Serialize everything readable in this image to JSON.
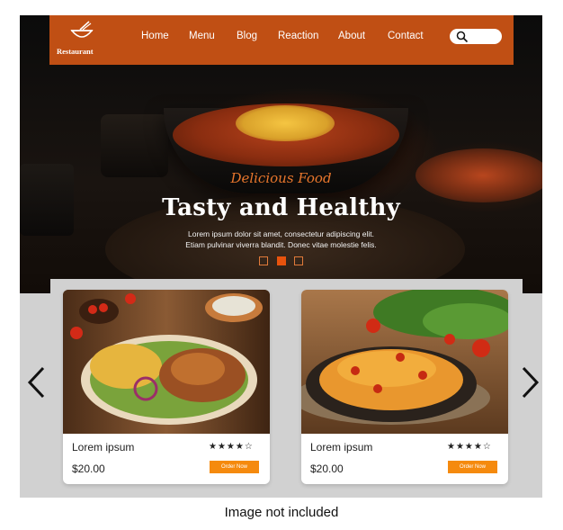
{
  "brand": {
    "name": "Restaurant",
    "accent": "#c04f14"
  },
  "nav": {
    "items": [
      "Home",
      "Menu",
      "Blog",
      "Reaction",
      "About",
      "Contact"
    ],
    "search_icon": "search-icon"
  },
  "hero": {
    "tagline": "Delicious Food",
    "headline": "Tasty and Healthy",
    "description_line1": "Lorem ipsum dolor sit amet, consectetur adipiscing elit.",
    "description_line2": "Etiam pulvinar viverra blandit. Donec vitae molestie felis.",
    "slides": 3,
    "active_slide": 2
  },
  "cards": [
    {
      "title": "Lorem ipsum",
      "price": "$20.00",
      "stars": "★★★★☆",
      "rating": 4,
      "button": "Order Now"
    },
    {
      "title": "Lorem ipsum",
      "price": "$20.00",
      "stars": "★★★★☆",
      "rating": 4,
      "button": "Order Now"
    }
  ],
  "caption": "Image not included",
  "colors": {
    "button": "#f58a0e",
    "band": "#d1d1d1",
    "dot_active": "#e8530d"
  }
}
